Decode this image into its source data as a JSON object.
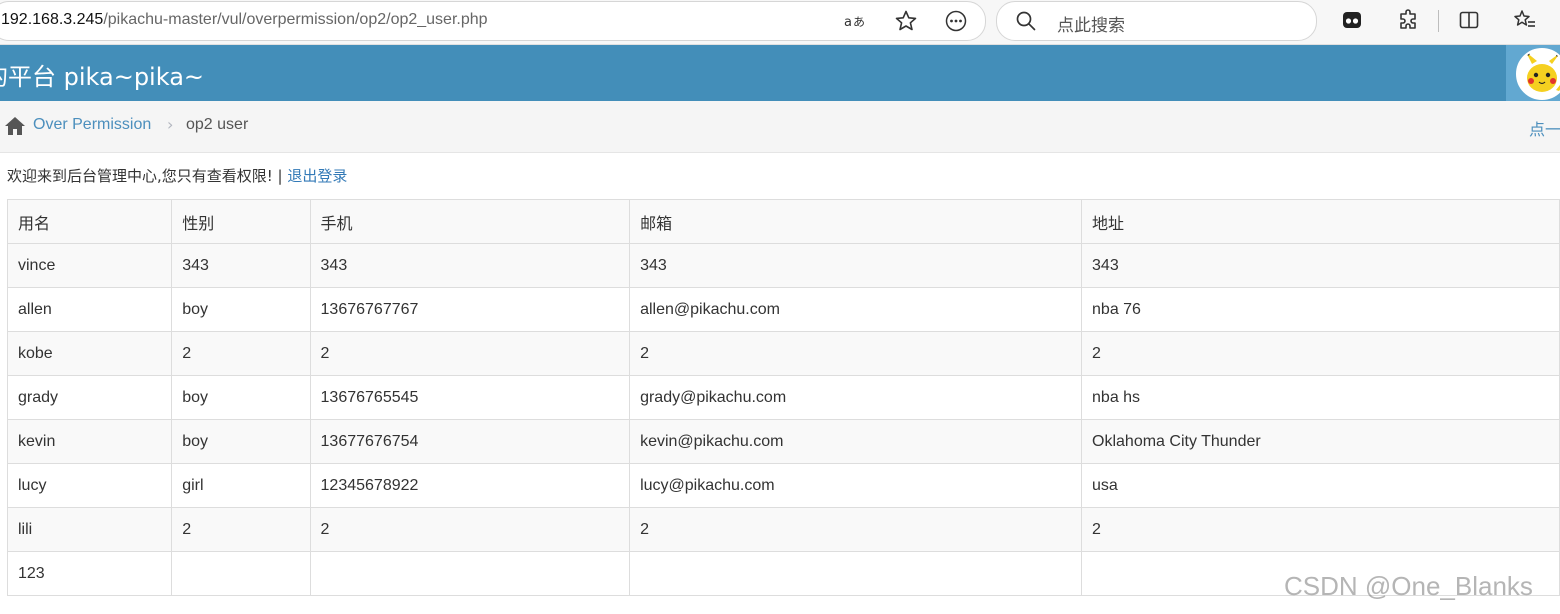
{
  "browser": {
    "url_host": "192.168.3.245",
    "url_path": "/pikachu-master/vul/overpermission/op2/op2_user.php",
    "search_placeholder": "点此搜索",
    "icons": [
      "read-aloud-icon",
      "favorite-star-icon",
      "more-icon",
      "search-icon",
      "extension-tile-icon",
      "puzzle-icon",
      "split-screen-icon",
      "favorites-list-icon"
    ]
  },
  "header": {
    "brand": "的平台 pika~pika~",
    "accent": "#438eb9"
  },
  "breadcrumb": {
    "parent": "Over Permission",
    "current": "op2 user",
    "right_link": "点一"
  },
  "welcome": {
    "text": "欢迎来到后台管理中心,您只有查看权限! | ",
    "logout": "退出登录"
  },
  "table": {
    "headers": [
      "用名",
      "性别",
      "手机",
      "邮箱",
      "地址"
    ],
    "rows": [
      [
        "vince",
        "343",
        "343",
        "343",
        "343"
      ],
      [
        "allen",
        "boy",
        "13676767767",
        "allen@pikachu.com",
        "nba 76"
      ],
      [
        "kobe",
        "2",
        "2",
        "2",
        "2"
      ],
      [
        "grady",
        "boy",
        "13676765545",
        "grady@pikachu.com",
        "nba hs"
      ],
      [
        "kevin",
        "boy",
        "13677676754",
        "kevin@pikachu.com",
        "Oklahoma City Thunder"
      ],
      [
        "lucy",
        "girl",
        "12345678922",
        "lucy@pikachu.com",
        "usa"
      ],
      [
        "lili",
        "2",
        "2",
        "2",
        "2"
      ],
      [
        "123",
        "",
        "",
        "",
        ""
      ]
    ]
  },
  "watermark": "CSDN @One_Blanks"
}
